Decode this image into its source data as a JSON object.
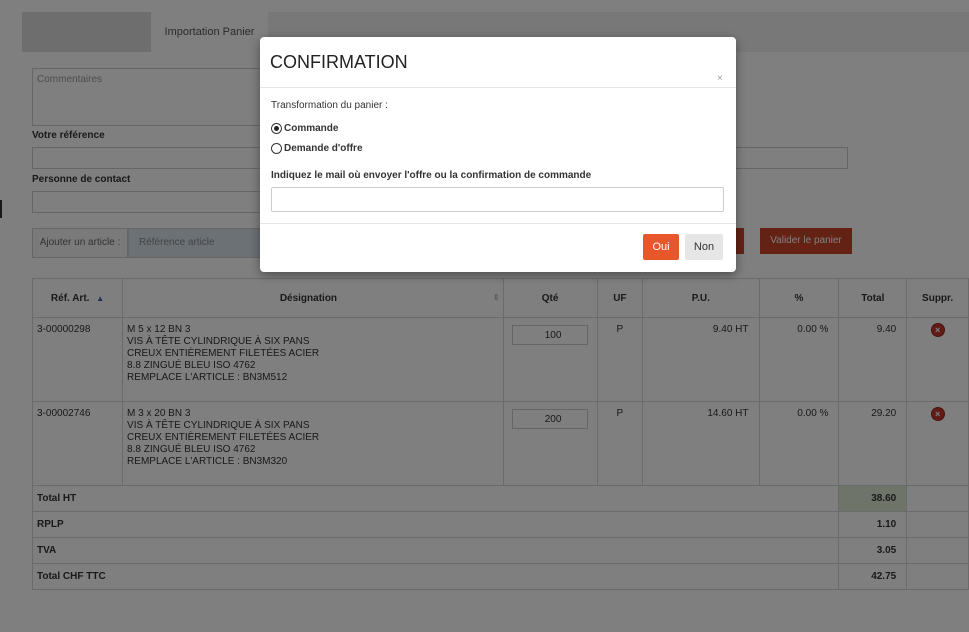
{
  "tabs": {
    "import_label": "Importation Panier"
  },
  "form": {
    "comment_placeholder": "Commentaires",
    "reference_label": "Votre référence",
    "contact_label": "Personne de contact",
    "add_article_label": "Ajouter un article :",
    "article_ref_placeholder": "Référence article",
    "validate_label": "Valider le panier"
  },
  "table": {
    "headers": [
      "Réf. Art.",
      "Désignation",
      "Qté",
      "UF",
      "P.U.",
      "%",
      "Total",
      "Suppr."
    ],
    "rows": [
      {
        "ref": "3-00000298",
        "designation": [
          "M 5 x 12 BN 3",
          "VIS À TÊTE CYLINDRIQUE À SIX PANS",
          "CREUX ENTIÈREMENT FILETÉES ACIER",
          "8.8 ZINGUÉ BLEU ISO 4762",
          "REMPLACE L'ARTICLE : BN3M512"
        ],
        "qty": "100",
        "uf": "P",
        "pu": "9.40 HT",
        "pct": "0.00 %",
        "total": "9.40"
      },
      {
        "ref": "3-00002746",
        "designation": [
          "M 3 x 20 BN 3",
          "VIS À TÊTE CYLINDRIQUE À SIX PANS",
          "CREUX ENTIÈREMENT FILETÉES ACIER",
          "8.8 ZINGUÉ BLEU ISO 4762",
          "REMPLACE L'ARTICLE : BN3M320"
        ],
        "qty": "200",
        "uf": "P",
        "pu": "14.60 HT",
        "pct": "0.00 %",
        "total": "29.20"
      }
    ],
    "totals": [
      {
        "label": "Total HT",
        "value": "38.60"
      },
      {
        "label": "RPLP",
        "value": "1.10"
      },
      {
        "label": "TVA",
        "value": "3.05"
      },
      {
        "label": "Total CHF TTC",
        "value": "42.75"
      }
    ]
  },
  "modal": {
    "title": "CONFIRMATION",
    "close": "×",
    "transform_label": "Transformation du panier :",
    "option_order": "Commande",
    "option_quote": "Demande d'offre",
    "selected": "Commande",
    "email_label": "Indiquez le mail où envoyer l'offre ou la confirmation de commande",
    "email_value": "",
    "yes_label": "Oui",
    "no_label": "Non"
  },
  "colors": {
    "accent": "#e8572a",
    "validate": "#c9442a",
    "total_highlight": "#dde9d3",
    "delete": "#c0392b"
  },
  "icons": {
    "sort": "sort-asc-icon",
    "delete": "delete-circle-icon"
  }
}
